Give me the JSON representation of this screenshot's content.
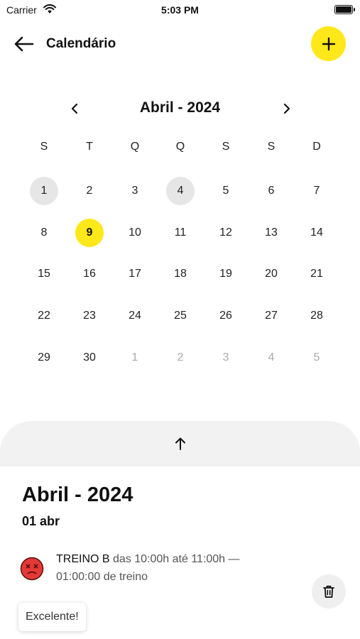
{
  "status_bar": {
    "carrier": "Carrier",
    "time": "5:03 PM"
  },
  "header": {
    "title": "Calendário"
  },
  "calendar": {
    "month_label": "Abril - 2024",
    "weekdays": [
      "S",
      "T",
      "Q",
      "Q",
      "S",
      "S",
      "D"
    ],
    "weeks": [
      [
        "1",
        "2",
        "3",
        "4",
        "5",
        "6",
        "7"
      ],
      [
        "8",
        "9",
        "10",
        "11",
        "12",
        "13",
        "14"
      ],
      [
        "15",
        "16",
        "17",
        "18",
        "19",
        "20",
        "21"
      ],
      [
        "22",
        "23",
        "24",
        "25",
        "26",
        "27",
        "28"
      ],
      [
        "29",
        "30",
        "1",
        "2",
        "3",
        "4",
        "5"
      ]
    ],
    "event_days": [
      "1",
      "4"
    ],
    "selected_day": "9"
  },
  "details": {
    "month_title": "Abril - 2024",
    "date_title": "01 abr",
    "events": [
      {
        "name": "TREINO B",
        "time_text": "das 10:00h até 11:00h —",
        "duration_text": "01:00:00 de treino",
        "mood_icon": "sad-face-icon"
      }
    ]
  },
  "toast": {
    "text": "Excelente!"
  },
  "colors": {
    "accent": "#FFE81A",
    "event_day": "#E6E6E6",
    "mood_red": "#E53935"
  }
}
